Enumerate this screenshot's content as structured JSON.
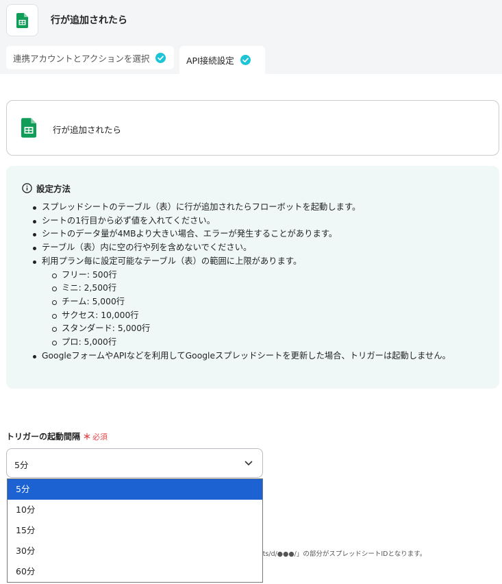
{
  "header": {
    "title": "行が追加されたら",
    "app_icon": "google-sheets-icon"
  },
  "tabs": [
    {
      "label": "連携アカウントとアクションを選択",
      "completed": true
    },
    {
      "label": "API接続設定",
      "completed": true
    }
  ],
  "trigger": {
    "label": "行が追加されたら",
    "icon": "google-sheets-icon"
  },
  "info": {
    "heading": "設定方法",
    "items": [
      "スプレッドシートのテーブル（表）に行が追加されたらフローボットを起動します。",
      "シートの1行目から必ず値を入れてください。",
      "シートのデータ量が4MBより大きい場合、エラーが発生することがあります。",
      "テーブル（表）内に空の行や列を含めないでください。",
      "利用プラン毎に設定可能なテーブル（表）の範囲に上限があります。"
    ],
    "plan_limits": [
      "フリー: 500行",
      "ミニ: 2,500行",
      "チーム: 5,000行",
      "サクセス: 10,000行",
      "スタンダード: 5,000行",
      "プロ: 5,000行"
    ],
    "last_item": "GoogleフォームやAPIなどを利用してGoogleスプレッドシートを更新した場合、トリガーは起動しません。"
  },
  "interval_field": {
    "label": "トリガーの起動間隔",
    "required_mark": "＊",
    "required_text": "必須",
    "selected": "5分",
    "options": [
      "5分",
      "10分",
      "15分",
      "30分",
      "60分"
    ]
  },
  "obscured_hint": "eets/d/●●●/」の部分がスプレッドシートIDとなります。",
  "colors": {
    "accent_check": "#1cc4d6",
    "sheets_green": "#0f9d58",
    "selected_option": "#1d62d3",
    "required": "#e5484d",
    "info_bg": "#f0f8f7"
  }
}
